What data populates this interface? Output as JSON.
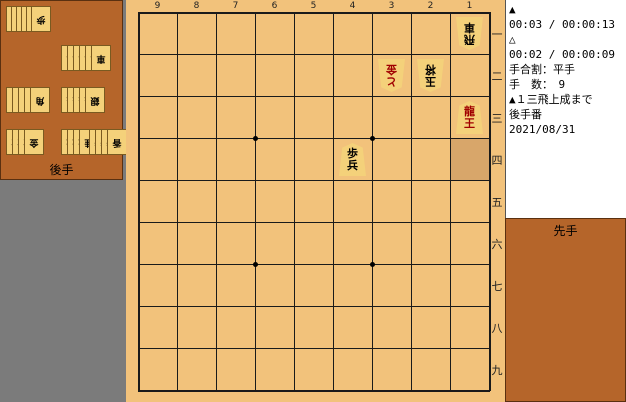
{
  "board": {
    "files": [
      "9",
      "8",
      "7",
      "6",
      "5",
      "4",
      "3",
      "2",
      "1"
    ],
    "ranks": [
      "一",
      "二",
      "三",
      "四",
      "五",
      "六",
      "七",
      "八",
      "九"
    ],
    "pieces": [
      {
        "file": 1,
        "rank": 1,
        "owner": "gote",
        "top": "飛",
        "bottom": "車",
        "promoted": false
      },
      {
        "file": 2,
        "rank": 2,
        "owner": "gote",
        "top": "玉",
        "bottom": "将",
        "promoted": false
      },
      {
        "file": 3,
        "rank": 2,
        "owner": "gote",
        "top": "と",
        "bottom": "金",
        "promoted": true
      },
      {
        "file": 1,
        "rank": 3,
        "owner": "sente",
        "top": "龍",
        "bottom": "王",
        "promoted": true
      },
      {
        "file": 4,
        "rank": 4,
        "owner": "sente",
        "top": "歩",
        "bottom": "兵",
        "promoted": false
      }
    ],
    "highlight": {
      "file": 1,
      "rank": 4
    }
  },
  "gote_hand": {
    "label": "後手",
    "stacks": [
      {
        "piece": "歩",
        "count": 16
      },
      {
        "piece": "車",
        "count": 6
      },
      {
        "piece": "角",
        "count": 5
      },
      {
        "piece": "銀",
        "count": 5
      },
      {
        "piece": "金",
        "count": 4
      },
      {
        "piece": "桂",
        "count": 4
      },
      {
        "piece": "香",
        "count": 4
      }
    ]
  },
  "sente_hand": {
    "label": "先手"
  },
  "info": {
    "lines": [
      "▲",
      "00:03 / 00:00:13",
      "△",
      "00:02 / 00:00:09",
      "手合割：平手",
      "手　数：　9",
      "▲１三飛上成まで",
      "後手番",
      "2021/08/31"
    ]
  },
  "colors": {
    "board": "#f2c27b",
    "hand": "#b5652a",
    "piece": "#f4d17a",
    "promoted": "#a00000",
    "background": "#7b7b7b"
  }
}
